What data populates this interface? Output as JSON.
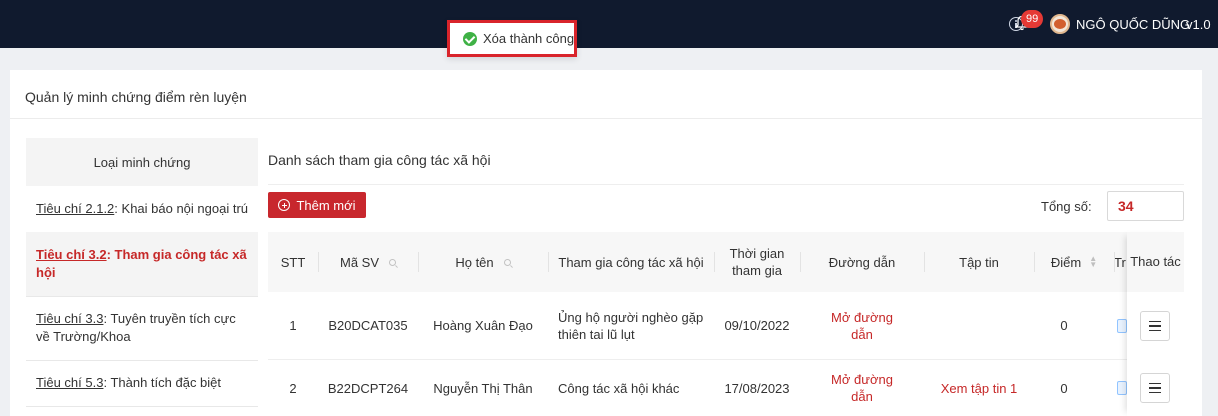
{
  "header": {
    "notification_count": "99",
    "user_name": "NGÔ QUỐC DŨNG",
    "version": "v1.0",
    "icons": [
      "info-icon",
      "bell-icon",
      "avatar"
    ]
  },
  "toast": {
    "message": "Xóa thành công",
    "icon": "check-circle-icon",
    "color": "#3fb145"
  },
  "page": {
    "title": "Quản lý minh chứng điểm rèn luyện"
  },
  "sidebar": {
    "header": "Loại minh chứng",
    "items": [
      {
        "criterion": "Tiêu chí 2.1.2",
        "label": ": Khai báo nội ngoại trú",
        "active": false
      },
      {
        "criterion": "Tiêu chí 3.2",
        "label": ": Tham gia công tác xã hội",
        "active": true
      },
      {
        "criterion": "Tiêu chí 3.3",
        "label": ": Tuyên truyền tích cực về Trường/Khoa",
        "active": false
      },
      {
        "criterion": "Tiêu chí 5.3",
        "label": ": Thành tích đặc biệt",
        "active": false
      }
    ]
  },
  "main": {
    "list_title": "Danh sách tham gia công tác xã hội",
    "add_button": "Thêm mới",
    "total_label": "Tổng số:",
    "total_value": "34",
    "columns": {
      "stt": "STT",
      "student_id": "Mã SV",
      "full_name": "Họ tên",
      "activity": "Tham gia công tác xã hội",
      "time": "Thời gian tham gia",
      "link": "Đường dẫn",
      "file": "Tập tin",
      "score": "Điểm",
      "status_partial": "Tr",
      "actions": "Thao tác"
    },
    "rows": [
      {
        "stt": "1",
        "student_id": "B20DCAT035",
        "full_name": "Hoàng Xuân Đạo",
        "activity": "Ủng hộ người nghèo gặp thiên tai lũ lụt",
        "time": "09/10/2022",
        "link": "Mở đường dẫn",
        "file": "",
        "score": "0"
      },
      {
        "stt": "2",
        "student_id": "B22DCPT264",
        "full_name": "Nguyễn Thị Thân",
        "activity": "Công tác xã hội khác",
        "time": "17/08/2023",
        "link": "Mở đường dẫn",
        "file": "Xem tập tin 1",
        "score": "0"
      }
    ]
  },
  "colors": {
    "topbar": "#101a2e",
    "accent_red": "#c8272d",
    "link_red": "#c62828",
    "highlight_border": "#d9242b"
  }
}
